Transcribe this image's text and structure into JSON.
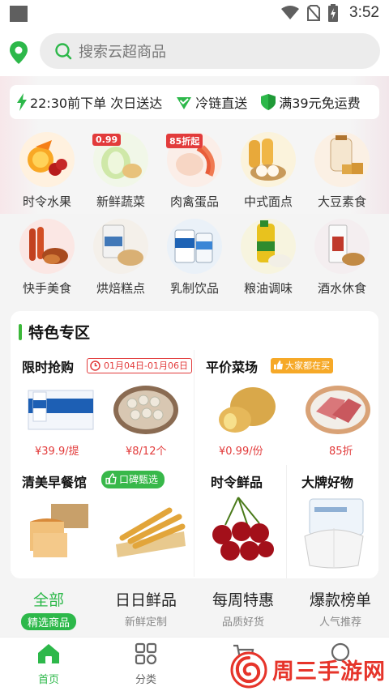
{
  "status_bar": {
    "time": "3:52"
  },
  "search": {
    "placeholder": "搜索云超商品"
  },
  "promises": [
    {
      "icon": "lightning-icon",
      "text": "22:30前下单 次日送达"
    },
    {
      "icon": "check-badge-icon",
      "text": "冷链直送"
    },
    {
      "icon": "shield-icon",
      "text": "满39元免运费"
    }
  ],
  "categories": [
    {
      "label": "时令水果",
      "icon": "fruit-icon"
    },
    {
      "label": "新鲜蔬菜",
      "icon": "vegetable-icon",
      "badge": "0.99"
    },
    {
      "label": "肉禽蛋品",
      "icon": "meat-icon",
      "badge": "85折起"
    },
    {
      "label": "中式面点",
      "icon": "bun-icon"
    },
    {
      "label": "大豆素食",
      "icon": "soy-icon"
    },
    {
      "label": "快手美食",
      "icon": "chicken-wing-icon"
    },
    {
      "label": "烘焙糕点",
      "icon": "bread-icon"
    },
    {
      "label": "乳制饮品",
      "icon": "milk-icon"
    },
    {
      "label": "粮油调味",
      "icon": "oil-icon"
    },
    {
      "label": "酒水休食",
      "icon": "liquor-icon"
    }
  ],
  "feature": {
    "title": "特色专区",
    "flash_sale": {
      "title": "限时抢购",
      "date_tag": "01月04日-01月06日",
      "prices": [
        "¥39.9/提",
        "¥8/12个"
      ]
    },
    "cheap_veg": {
      "title": "平价菜场",
      "tag": "大家都在买",
      "prices": [
        "¥0.99/份",
        "85折"
      ]
    },
    "breakfast": {
      "title": "清美早餐馆",
      "tag": "口碑甄选"
    },
    "seasonal": {
      "title": "时令鲜品"
    },
    "brands": {
      "title": "大牌好物"
    }
  },
  "tabs": [
    {
      "title": "全部",
      "sub": "精选商品",
      "active": true
    },
    {
      "title": "日日鲜品",
      "sub": "新鲜定制"
    },
    {
      "title": "每周特惠",
      "sub": "品质好货"
    },
    {
      "title": "爆款榜单",
      "sub": "人气推荐"
    }
  ],
  "bottom_nav": [
    {
      "label": "首页",
      "icon": "home-icon",
      "active": true
    },
    {
      "label": "分类",
      "icon": "category-grid-icon"
    },
    {
      "label": "",
      "icon": "cart-icon"
    },
    {
      "label": "",
      "icon": "profile-icon"
    }
  ],
  "watermark": {
    "text": "周三手游网"
  },
  "colors": {
    "brand_green": "#2db84a",
    "price_red": "#e23b3b",
    "tag_orange": "#f6a928"
  }
}
